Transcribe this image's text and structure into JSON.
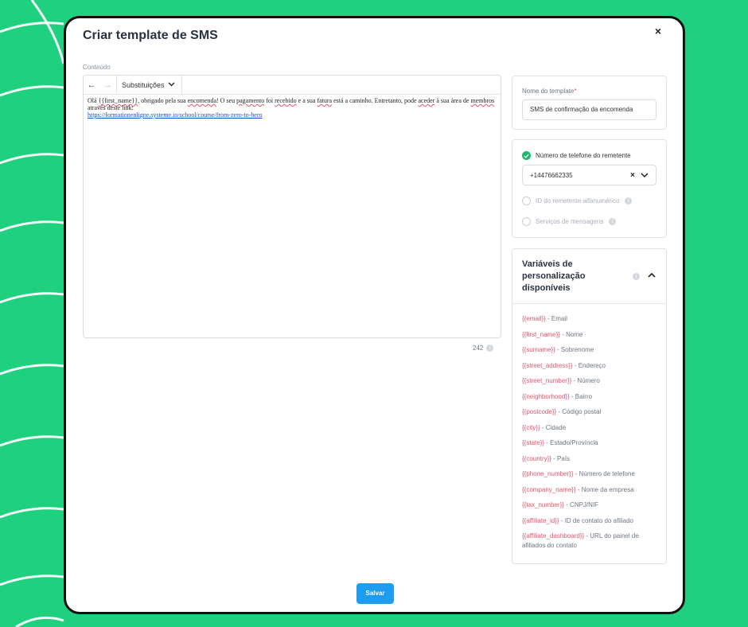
{
  "modal": {
    "title": "Criar template de SMS",
    "close": "×",
    "save_label": "Salvar"
  },
  "editor": {
    "label": "Conteúdo",
    "toolbar": {
      "undo": "←",
      "redo": "→",
      "substitutions": "Substituições",
      "chevron": "⌄"
    },
    "text": {
      "p1": "Olá ",
      "p2": "{{first_name}}",
      "p3": ", obrigado pela sua ",
      "p4": "encomenda",
      "p5": "! O seu ",
      "p6": "pagamento",
      "p7": " foi ",
      "p8": "recebido",
      "p9": " e a sua ",
      "p10": "fatura",
      "p11": " está a caminho. Entretanto, pode ",
      "p12": "aceder",
      "p13": " à sua área de ",
      "p14": "membros",
      "p15": " através deste link:",
      "link": "https://formationenligne.systeme.io/school/course/from-zero-to-hero"
    },
    "char_count": "242"
  },
  "template_name": {
    "label": "Nome do template",
    "required_mark": "*",
    "value": "SMS de confirmação da encomenda"
  },
  "sender": {
    "phone_option_label": "Número de telefone do remetente",
    "phone_value": "+14476662335",
    "alphanumeric_label": "ID do remetente alfanumérico",
    "messaging_services_label": "Serviços de mensagens"
  },
  "variables": {
    "title": "Variáveis de personalização disponíveis",
    "items": [
      {
        "token": "{{email}}",
        "desc": " - Email"
      },
      {
        "token": "{{first_name}}",
        "desc": " - Nome"
      },
      {
        "token": "{{surname}}",
        "desc": " - Sobrenome"
      },
      {
        "token": "{{street_address}}",
        "desc": " - Endereço"
      },
      {
        "token": "{{street_number}}",
        "desc": " - Número"
      },
      {
        "token": "{{neighborhood}}",
        "desc": " - Bairro"
      },
      {
        "token": "{{postcode}}",
        "desc": " - Código postal"
      },
      {
        "token": "{{city}}",
        "desc": " - Cidade"
      },
      {
        "token": "{{state}}",
        "desc": " - Estado/Província"
      },
      {
        "token": "{{country}}",
        "desc": " - País"
      },
      {
        "token": "{{phone_number}}",
        "desc": " - Número de telefone"
      },
      {
        "token": "{{company_name}}",
        "desc": " - Nome da empresa"
      },
      {
        "token": "{{tax_number}}",
        "desc": " - CNPJ/NIF"
      },
      {
        "token": "{{affiliate_id}}",
        "desc": " - ID de contato do afiliado"
      },
      {
        "token": "{{affiliate_dashboard}}",
        "desc": " - URL do painel de afiliados do contato"
      }
    ]
  },
  "colors": {
    "background": "#1fd17f",
    "accent_button": "#1e9cf0",
    "variable_token": "#e0566d",
    "check_green": "#1db86b"
  }
}
